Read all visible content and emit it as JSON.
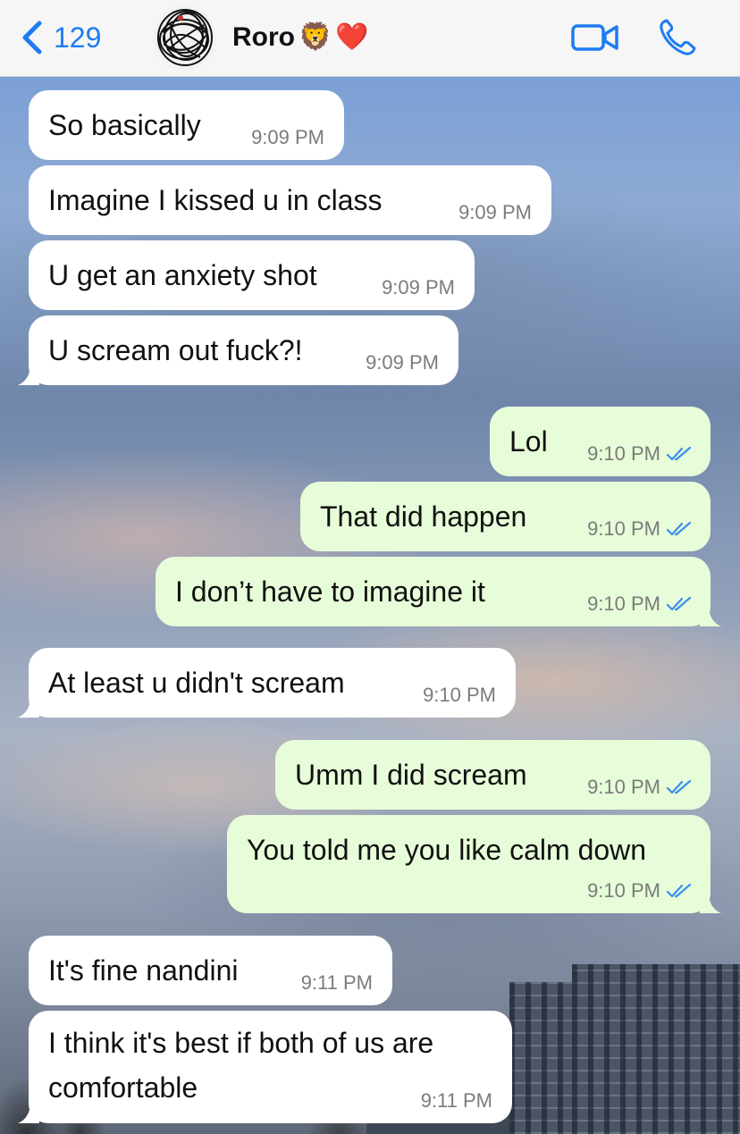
{
  "header": {
    "back_count": "129",
    "contact_name": "Roro",
    "emoji_lion": "🦁",
    "emoji_heart": "❤️",
    "icons": [
      "chevron-left-icon",
      "video-call-icon",
      "phone-icon"
    ]
  },
  "colors": {
    "accent": "#1e7cf2",
    "incoming_bubble": "#ffffff",
    "outgoing_bubble": "#e7fcd8",
    "read_tick": "#3b8ef0",
    "timestamp": "#7b7b7b"
  },
  "messages": [
    {
      "dir": "in",
      "text": "So basically",
      "time": "9:09 PM"
    },
    {
      "dir": "in",
      "text": "Imagine I kissed u in class",
      "time": "9:09 PM"
    },
    {
      "dir": "in",
      "text": "U get an anxiety shot",
      "time": "9:09 PM"
    },
    {
      "dir": "in",
      "text": "U scream out fuck?!",
      "time": "9:09 PM"
    },
    {
      "dir": "out",
      "text": "Lol",
      "time": "9:10 PM"
    },
    {
      "dir": "out",
      "text": "That did happen",
      "time": "9:10 PM"
    },
    {
      "dir": "out",
      "text": "I don’t have to imagine it",
      "time": "9:10 PM"
    },
    {
      "dir": "in",
      "text": "At least u didn't scream",
      "time": "9:10 PM"
    },
    {
      "dir": "out",
      "text": "Umm I did scream",
      "time": "9:10 PM"
    },
    {
      "dir": "out",
      "text": "You told me you like calm down",
      "time": "9:10 PM"
    },
    {
      "dir": "in",
      "text": "It's fine nandini",
      "time": "9:11 PM"
    },
    {
      "dir": "in",
      "text_line1": "I think it's best if both of us are",
      "text_line2": "comfortable",
      "time": "9:11 PM"
    }
  ]
}
